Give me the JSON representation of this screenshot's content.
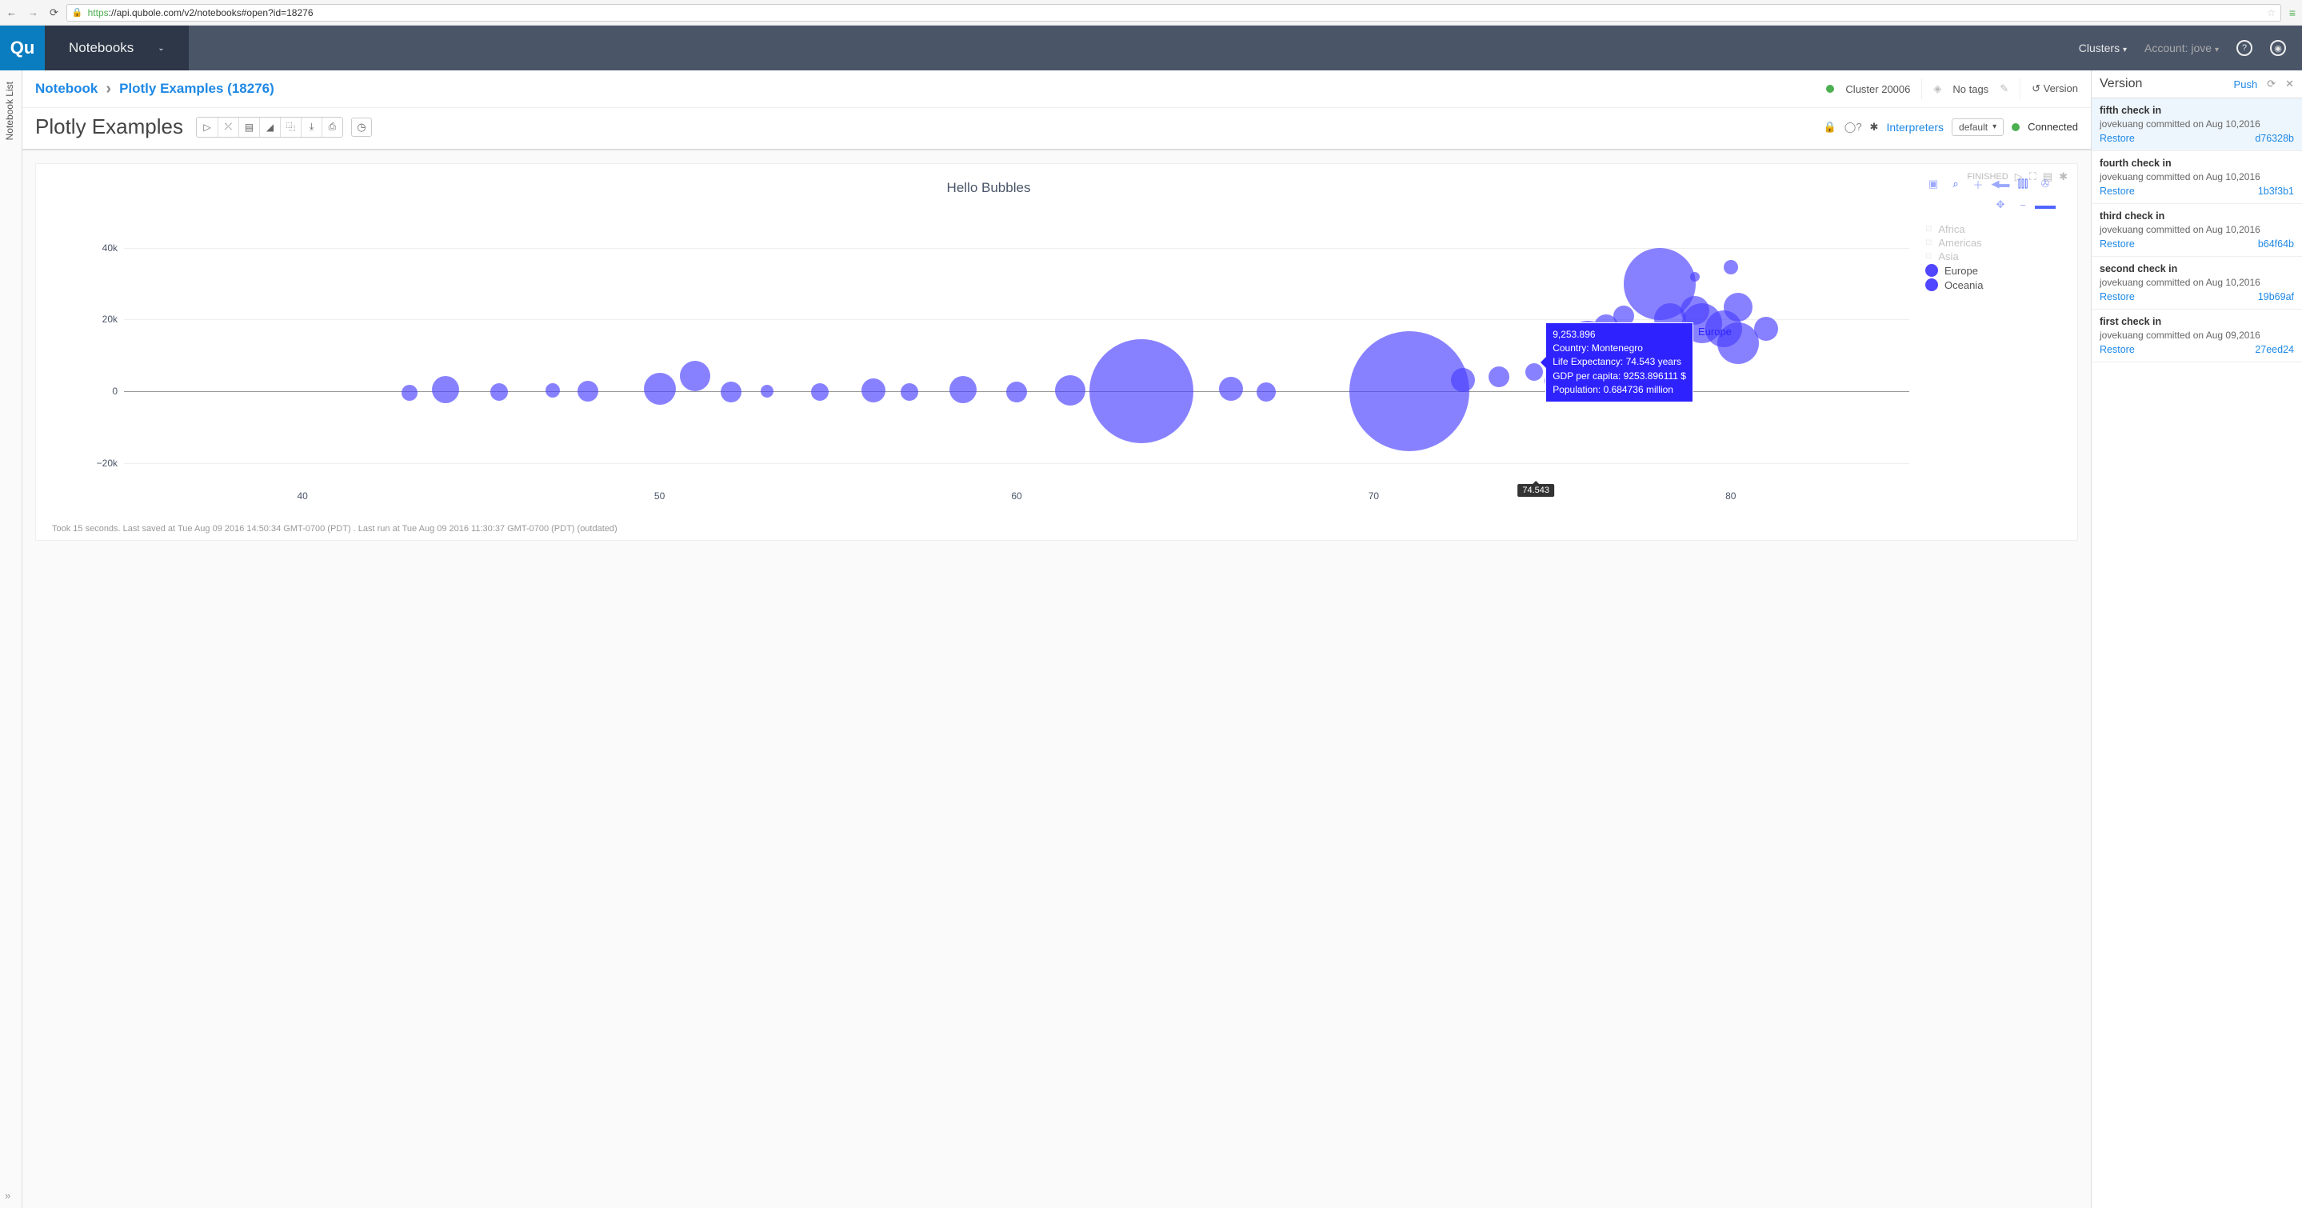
{
  "browser": {
    "url_https": "https",
    "url_rest": "://api.qubole.com/v2/notebooks#open?id=18276"
  },
  "header": {
    "logo": "Qu",
    "module": "Notebooks",
    "clusters": "Clusters",
    "account_label": "Account: ",
    "account_name": "jove"
  },
  "sidebar": {
    "tab_label": "Notebook List",
    "expand": "»"
  },
  "breadcrumb": {
    "root": "Notebook",
    "current": "Plotly Examples (18276)"
  },
  "info": {
    "cluster": "Cluster 20006",
    "tags": "No tags",
    "version_btn": "Version"
  },
  "notebook": {
    "title": "Plotly Examples",
    "interpreters": "Interpreters",
    "default": "default",
    "connected": "Connected"
  },
  "cell": {
    "status": "FINISHED",
    "footer": "Took 15 seconds. Last saved at Tue Aug 09 2016 14:50:34 GMT-0700 (PDT) . Last run at Tue Aug 09 2016 11:30:37 GMT-0700 (PDT) (outdated)"
  },
  "chart_data": {
    "type": "scatter",
    "title": "Hello Bubbles",
    "xlabel": "",
    "ylabel": "",
    "xlim": [
      35,
      85
    ],
    "ylim": [
      -25000,
      50000
    ],
    "xticks": [
      40,
      50,
      60,
      70,
      80
    ],
    "yticks": [
      -20000,
      0,
      20000,
      40000
    ],
    "ytick_labels": [
      "−20k",
      "0",
      "20k",
      "40k"
    ],
    "legend": [
      {
        "name": "Africa",
        "visible": false
      },
      {
        "name": "Americas",
        "visible": false
      },
      {
        "name": "Asia",
        "visible": false
      },
      {
        "name": "Europe",
        "visible": true
      },
      {
        "name": "Oceania",
        "visible": true
      }
    ],
    "hover": {
      "series": "Europe",
      "x_label": "74.543",
      "lines": [
        "9,253.896",
        "Country: Montenegro",
        "Life Expectancy: 74.543 years",
        "GDP per capita: 9253.896111 $",
        "Population: 0.684736 million"
      ]
    },
    "series": [
      {
        "name": "Europe",
        "points": [
          {
            "x": 43,
            "y": -400,
            "size": 20
          },
          {
            "x": 44,
            "y": 400,
            "size": 34
          },
          {
            "x": 45.5,
            "y": -300,
            "size": 22
          },
          {
            "x": 47,
            "y": 200,
            "size": 18
          },
          {
            "x": 48,
            "y": -100,
            "size": 26
          },
          {
            "x": 50,
            "y": 600,
            "size": 40
          },
          {
            "x": 51,
            "y": 4300,
            "size": 38
          },
          {
            "x": 52,
            "y": -200,
            "size": 26
          },
          {
            "x": 53,
            "y": 100,
            "size": 16
          },
          {
            "x": 54.5,
            "y": -300,
            "size": 22
          },
          {
            "x": 56,
            "y": 200,
            "size": 30
          },
          {
            "x": 57,
            "y": -200,
            "size": 22
          },
          {
            "x": 58.5,
            "y": 400,
            "size": 34
          },
          {
            "x": 60,
            "y": -300,
            "size": 26
          },
          {
            "x": 61.5,
            "y": 200,
            "size": 38
          },
          {
            "x": 63.5,
            "y": 0,
            "size": 130
          },
          {
            "x": 66,
            "y": 600,
            "size": 30
          },
          {
            "x": 67,
            "y": -200,
            "size": 24
          },
          {
            "x": 71,
            "y": 0,
            "size": 150
          },
          {
            "x": 72.5,
            "y": 3200,
            "size": 30
          },
          {
            "x": 73.5,
            "y": 4000,
            "size": 26
          },
          {
            "x": 74.5,
            "y": 5400,
            "size": 22
          },
          {
            "x": 75,
            "y": 2800,
            "size": 20
          },
          {
            "x": 76,
            "y": 13000,
            "size": 60
          },
          {
            "x": 76.5,
            "y": 18000,
            "size": 30
          },
          {
            "x": 77,
            "y": 21000,
            "size": 26
          },
          {
            "x": 78,
            "y": 30000,
            "size": 90
          },
          {
            "x": 78.3,
            "y": 20000,
            "size": 40
          },
          {
            "x": 79,
            "y": 22500,
            "size": 36
          },
          {
            "x": 79.2,
            "y": 19000,
            "size": 50
          },
          {
            "x": 79.8,
            "y": 17500,
            "size": 46
          },
          {
            "x": 80.2,
            "y": 23500,
            "size": 36
          },
          {
            "x": 81,
            "y": 17500,
            "size": 30
          },
          {
            "x": 80.2,
            "y": 13500,
            "size": 52
          }
        ]
      },
      {
        "name": "Oceania",
        "points": [
          {
            "x": 79,
            "y": 32000,
            "size": 12
          },
          {
            "x": 80,
            "y": 34500,
            "size": 18
          }
        ]
      }
    ]
  },
  "versions": {
    "title": "Version",
    "push": "Push",
    "restore": "Restore",
    "items": [
      {
        "title": "fifth check in",
        "meta": "jovekuang committed on Aug 10,2016",
        "hash": "d76328b",
        "selected": true
      },
      {
        "title": "fourth check in",
        "meta": "jovekuang committed on Aug 10,2016",
        "hash": "1b3f3b1"
      },
      {
        "title": "third check in",
        "meta": "jovekuang committed on Aug 10,2016",
        "hash": "b64f64b"
      },
      {
        "title": "second check in",
        "meta": "jovekuang committed on Aug 10,2016",
        "hash": "19b69af"
      },
      {
        "title": "first check in",
        "meta": "jovekuang committed on Aug 09,2016",
        "hash": "27eed24"
      }
    ]
  }
}
